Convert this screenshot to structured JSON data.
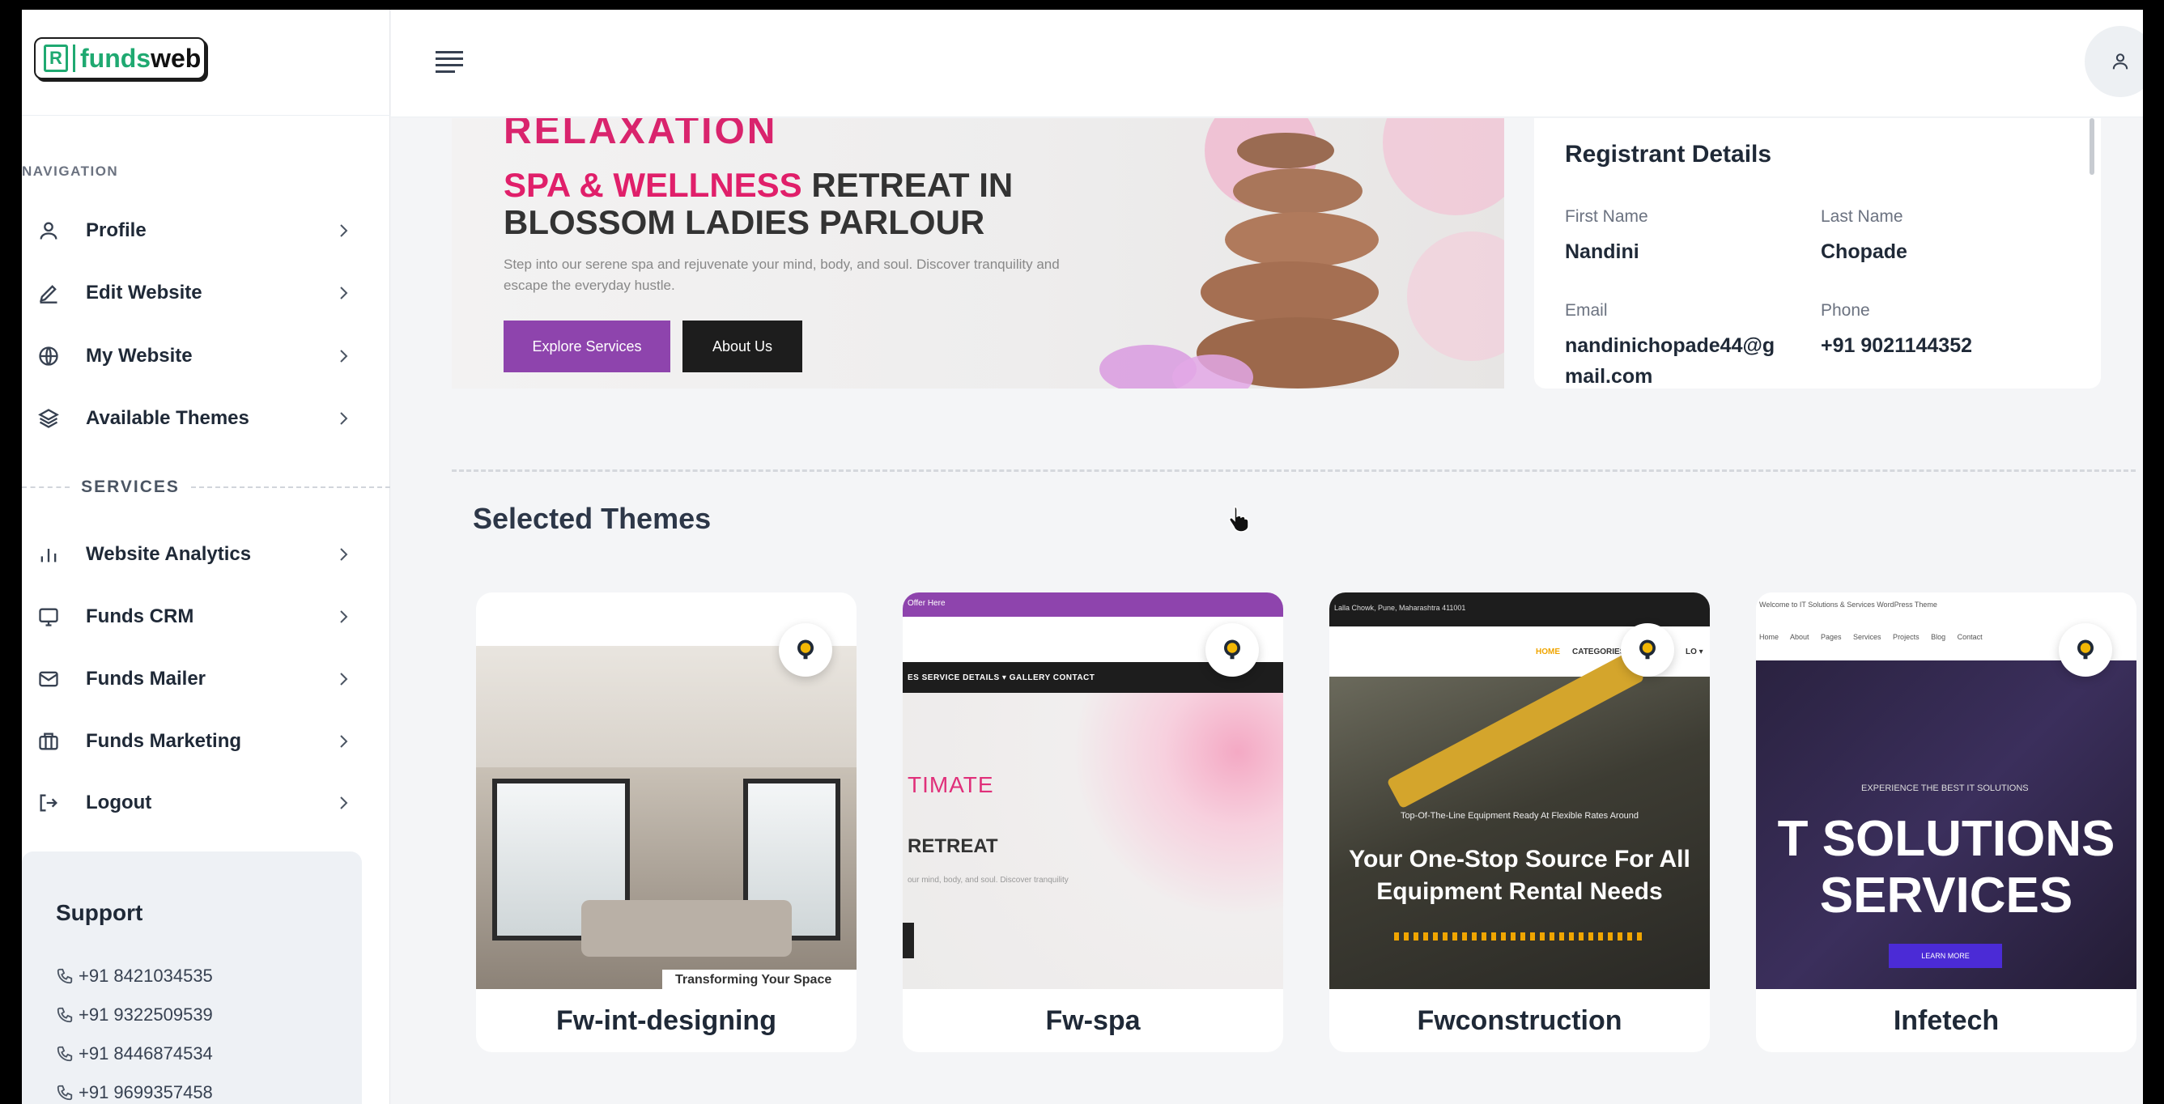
{
  "brand": {
    "logo_text_1": "funds",
    "logo_text_2": "web",
    "logo_mark": "R"
  },
  "sidebar": {
    "nav_heading": "NAVIGATION",
    "items": [
      {
        "label": "Profile",
        "icon": "user-icon"
      },
      {
        "label": "Edit Website",
        "icon": "pencil-icon"
      },
      {
        "label": "My Website",
        "icon": "globe-icon"
      },
      {
        "label": "Available Themes",
        "icon": "layers-icon"
      }
    ],
    "services_heading": "SERVICES",
    "services": [
      {
        "label": "Website Analytics",
        "icon": "bar-chart-icon"
      },
      {
        "label": "Funds CRM",
        "icon": "monitor-icon"
      },
      {
        "label": "Funds Mailer",
        "icon": "mail-icon"
      },
      {
        "label": "Funds Marketing",
        "icon": "briefcase-icon"
      },
      {
        "label": "Logout",
        "icon": "logout-icon"
      }
    ],
    "support": {
      "title": "Support",
      "phones": [
        "+91 8421034535",
        "+91 9322509539",
        "+91 8446874534",
        "+91 9699357458"
      ]
    }
  },
  "hero": {
    "top_text": "RELAXATION",
    "title_pink": "SPA & WELLNESS",
    "title_rest": " RETREAT IN BLOSSOM LADIES PARLOUR",
    "description": "Step into our serene spa and rejuvenate your mind, body, and soul. Discover tranquility and escape the everyday hustle.",
    "btn_primary": "Explore Services",
    "btn_secondary": "About Us"
  },
  "registrant": {
    "title": "Registrant Details",
    "first_name_label": "First Name",
    "first_name": "Nandini",
    "last_name_label": "Last Name",
    "last_name": "Chopade",
    "email_label": "Email",
    "email_line1": "nandinichopade44@g",
    "email_line2": "mail.com",
    "phone_label": "Phone",
    "phone": "+91 9021144352"
  },
  "selected_themes": {
    "title": "Selected Themes",
    "themes": [
      {
        "name": "Fw-int-designing",
        "preview_caption": "Transforming Your Space"
      },
      {
        "name": "Fw-spa",
        "preview_top": "Offer Here",
        "preview_nav": "ES   SERVICE DETAILS ▾   GALLERY   CONTACT",
        "preview_h1": "TIMATE",
        "preview_h2": "RETREAT",
        "preview_p": "our mind, body, and soul. Discover tranquility"
      },
      {
        "name": "Fwconstruction",
        "preview_top": "Lalla Chowk, Pune, Maharashtra 411001",
        "preview_nav_1": "HOME",
        "preview_nav_2": "CATEGORIES",
        "preview_nav_3": "LO ▾",
        "preview_small": "Top-Of-The-Line Equipment Ready At Flexible Rates Around",
        "preview_h1": "Your One-Stop Source For All",
        "preview_h2": "Equipment Rental Needs"
      },
      {
        "name": "Infetech",
        "preview_top": "Welcome to IT Solutions & Services WordPress Theme",
        "preview_nav": "Home About Pages Services Projects Blog Contact",
        "preview_small": "EXPERIENCE THE BEST IT SOLUTIONS",
        "preview_h1": "T SOLUTIONS",
        "preview_h2": "SERVICES",
        "preview_btn": "LEARN MORE"
      }
    ]
  },
  "colors": {
    "brand_green": "#1fa971",
    "accent_purple": "#8e44ad",
    "accent_pink": "#e01f6a"
  }
}
